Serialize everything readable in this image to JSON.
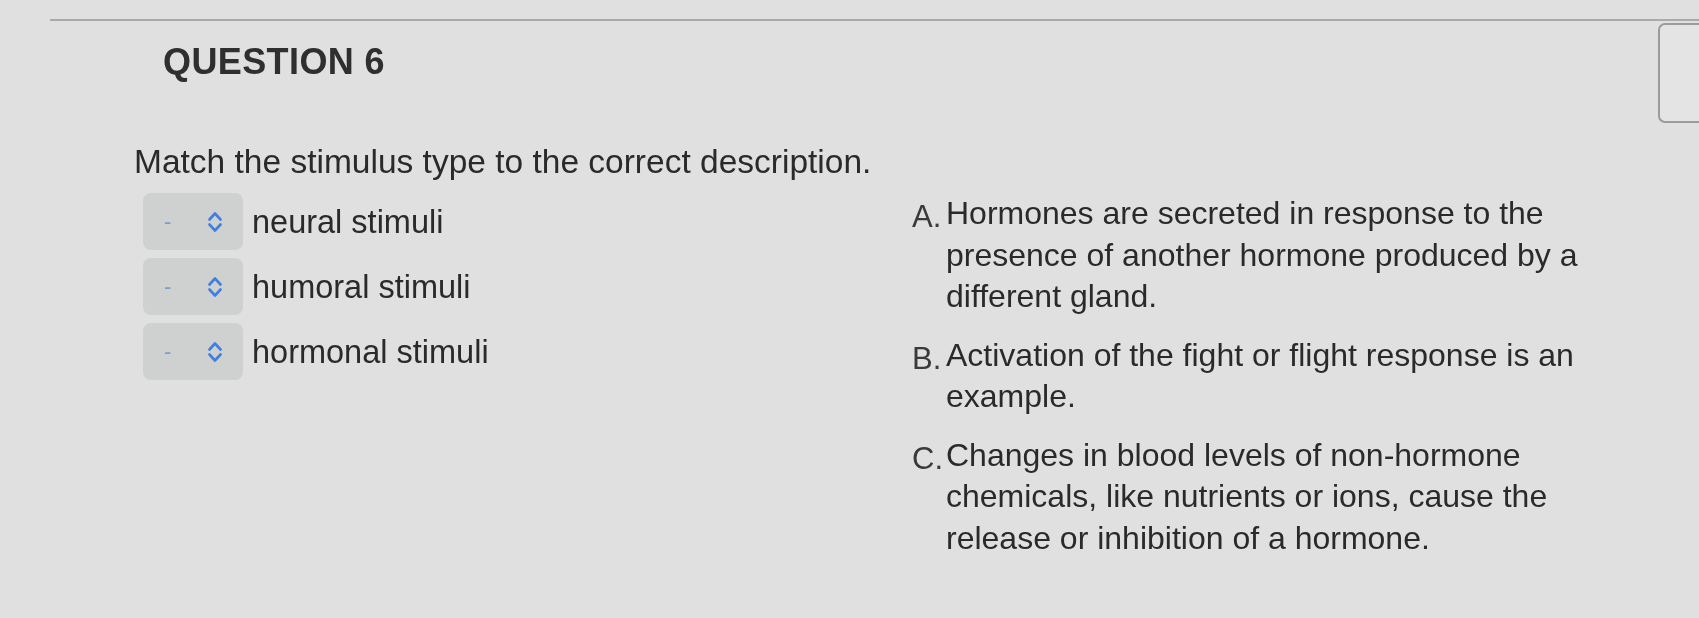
{
  "question": {
    "title": "QUESTION 6",
    "prompt": "Match the stimulus type to the correct description."
  },
  "matches": [
    {
      "value": "-",
      "label": "neural stimuli"
    },
    {
      "value": "-",
      "label": "humoral stimuli"
    },
    {
      "value": "-",
      "label": "hormonal stimuli"
    }
  ],
  "answers": [
    {
      "letter": "A.",
      "text": "Hormones are secreted in response to the presence of another hormone produced by a different gland."
    },
    {
      "letter": "B.",
      "text": "Activation of the fight or flight response is an example."
    },
    {
      "letter": "C.",
      "text": "Changes in blood levels of non-hormone chemicals, like nutrients or ions, cause the release or inhibition of a hormone."
    }
  ]
}
